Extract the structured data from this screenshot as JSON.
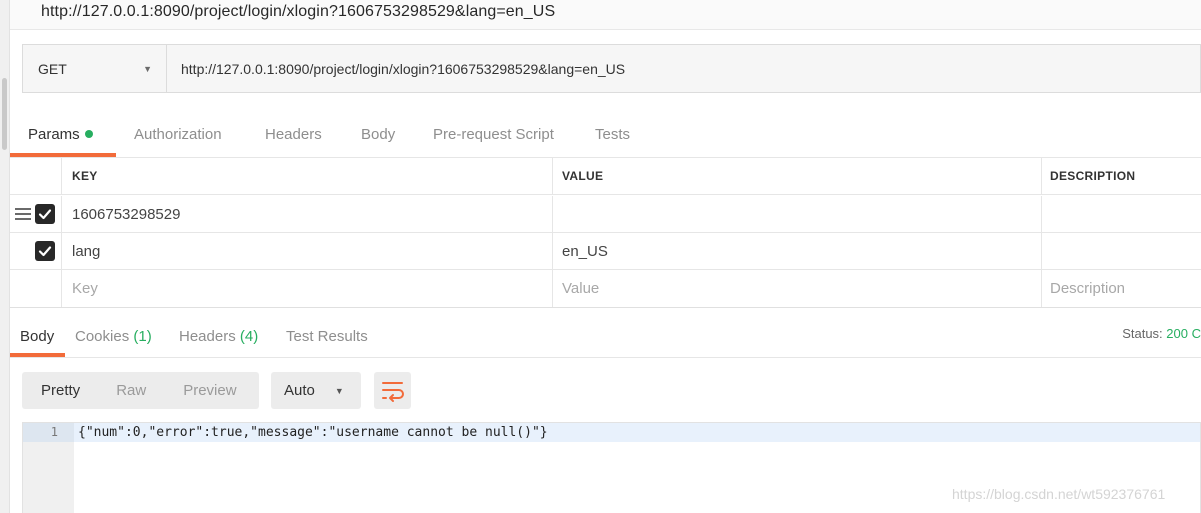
{
  "window": {
    "title": "http://127.0.0.1:8090/project/login/xlogin?1606753298529&lang=en_US"
  },
  "request": {
    "method": "GET",
    "url": "http://127.0.0.1:8090/project/login/xlogin?1606753298529&lang=en_US"
  },
  "request_tabs": [
    {
      "label": "Params",
      "active": true,
      "indicator_color": "#27ae60"
    },
    {
      "label": "Authorization"
    },
    {
      "label": "Headers"
    },
    {
      "label": "Body"
    },
    {
      "label": "Pre-request Script"
    },
    {
      "label": "Tests"
    }
  ],
  "params": {
    "columns": [
      "KEY",
      "VALUE",
      "DESCRIPTION"
    ],
    "rows": [
      {
        "checked": true,
        "key": "1606753298529",
        "value": "",
        "description": ""
      },
      {
        "checked": true,
        "key": "lang",
        "value": "en_US",
        "description": ""
      }
    ],
    "placeholder": {
      "key": "Key",
      "value": "Value",
      "description": "Description"
    }
  },
  "response_tabs": [
    {
      "label": "Body",
      "active": true
    },
    {
      "label": "Cookies",
      "count": "(1)"
    },
    {
      "label": "Headers",
      "count": "(4)"
    },
    {
      "label": "Test Results"
    }
  ],
  "status": {
    "label": "Status:",
    "code": "200 C"
  },
  "format": {
    "buttons": [
      "Pretty",
      "Raw",
      "Preview"
    ],
    "active": "Pretty",
    "select": "Auto"
  },
  "editor": {
    "line_number": "1",
    "code": "{\"num\":0,\"error\":true,\"message\":\"username cannot be null()\"}"
  },
  "watermark": "https://blog.csdn.net/wt592376761",
  "colors": {
    "accent": "#f26b3a",
    "success": "#27ae60"
  }
}
